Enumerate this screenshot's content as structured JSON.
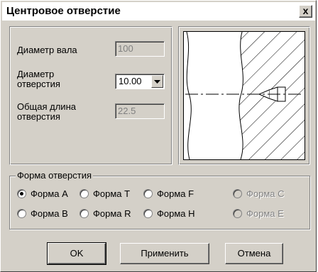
{
  "window": {
    "title": "Центровое отверстие",
    "close_label": "x"
  },
  "params": {
    "shaft_diameter_label": "Диаметр вала",
    "shaft_diameter_value": "100",
    "hole_diameter_label": "Диаметр отверстия",
    "hole_diameter_value": "10.00",
    "total_length_label": "Общая длина отверстия",
    "total_length_value": "22.5"
  },
  "shape_group": {
    "title": "Форма отверстия",
    "row1": [
      {
        "label": "Форма A",
        "selected": true,
        "enabled": true
      },
      {
        "label": "Форма T",
        "selected": false,
        "enabled": true
      },
      {
        "label": "Форма F",
        "selected": false,
        "enabled": true
      },
      {
        "label": "Форма C",
        "selected": false,
        "enabled": false
      }
    ],
    "row2": [
      {
        "label": "Форма B",
        "selected": false,
        "enabled": true
      },
      {
        "label": "Форма R",
        "selected": false,
        "enabled": true
      },
      {
        "label": "Форма H",
        "selected": false,
        "enabled": true
      },
      {
        "label": "Форма E",
        "selected": false,
        "enabled": false
      }
    ]
  },
  "buttons": {
    "ok": "OK",
    "apply": "Применить",
    "cancel": "Отмена"
  }
}
